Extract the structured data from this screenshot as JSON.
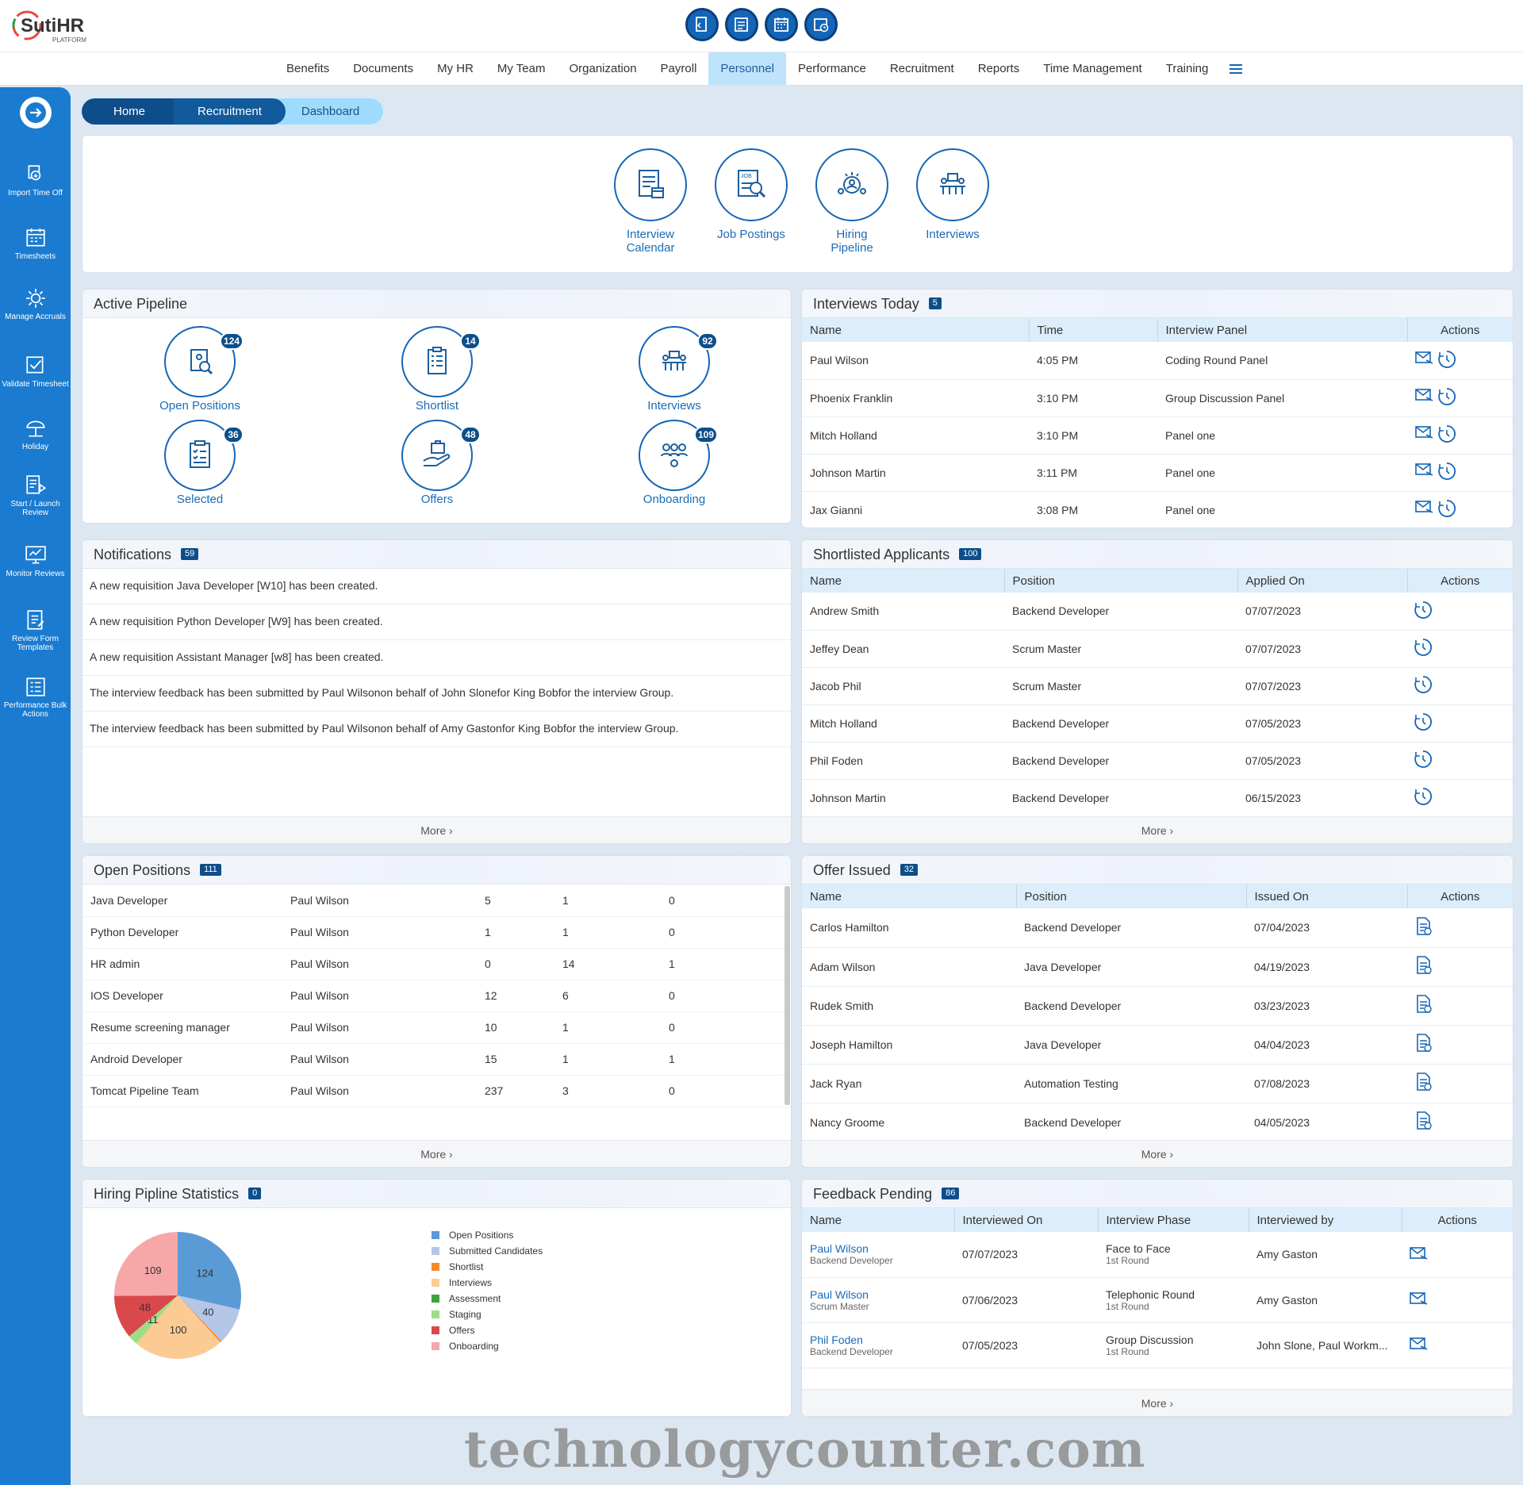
{
  "app": {
    "brand": "SutiHR",
    "brand_sub": "PLATFORM"
  },
  "top_icons": [
    "document-icon",
    "timesheet-icon",
    "calendar-icon",
    "calendar-clock-icon"
  ],
  "nav": {
    "items": [
      "Benefits",
      "Documents",
      "My HR",
      "My Team",
      "Organization",
      "Payroll",
      "Personnel",
      "Performance",
      "Recruitment",
      "Reports",
      "Time Management",
      "Training"
    ],
    "active": "Personnel"
  },
  "sidebar": {
    "menu_label": "Menu",
    "items": [
      {
        "label": "Import Time Off",
        "icon": "import-time-off-icon"
      },
      {
        "label": "Timesheets",
        "icon": "timesheets-icon"
      },
      {
        "label": "Manage Accruals",
        "icon": "gear-icon"
      },
      {
        "label": "Validate Timesheet",
        "icon": "validate-icon"
      },
      {
        "label": "Holiday",
        "icon": "beach-umbrella-icon"
      },
      {
        "label": "Start / Launch Review",
        "icon": "launch-review-icon"
      },
      {
        "label": "Monitor Reviews",
        "icon": "monitor-icon"
      },
      {
        "label": "Review Form Templates",
        "icon": "form-template-icon"
      },
      {
        "label": "Performance Bulk Actions",
        "icon": "bulk-actions-icon"
      }
    ]
  },
  "breadcrumb": [
    "Home",
    "Recruitment",
    "Dashboard"
  ],
  "quick_links": [
    {
      "label": "Interview Calendar",
      "icon": "interview-calendar-icon"
    },
    {
      "label": "Job Postings",
      "icon": "job-postings-icon"
    },
    {
      "label": "Hiring Pipeline",
      "icon": "hiring-pipeline-icon"
    },
    {
      "label": "Interviews",
      "icon": "interviews-icon"
    }
  ],
  "active_pipeline": {
    "title": "Active Pipeline",
    "items": [
      {
        "label": "Open Positions",
        "count": "124"
      },
      {
        "label": "Shortlist",
        "count": "14"
      },
      {
        "label": "Interviews",
        "count": "92"
      },
      {
        "label": "Selected",
        "count": "36"
      },
      {
        "label": "Offers",
        "count": "48"
      },
      {
        "label": "Onboarding",
        "count": "109"
      }
    ]
  },
  "interviews_today": {
    "title": "Interviews Today",
    "count": "5",
    "columns": [
      "Name",
      "Time",
      "Interview Panel",
      "Actions"
    ],
    "rows": [
      [
        "Paul Wilson",
        "4:05 PM",
        "Coding Round Panel"
      ],
      [
        "Phoenix Franklin",
        "3:10 PM",
        "Group Discussion Panel"
      ],
      [
        "Mitch Holland",
        "3:10 PM",
        "Panel one"
      ],
      [
        "Johnson Martin",
        "3:11 PM",
        "Panel one"
      ],
      [
        "Jax Gianni",
        "3:08 PM",
        "Panel one"
      ]
    ]
  },
  "notifications": {
    "title": "Notifications",
    "count": "59",
    "items": [
      "A new requisition Java Developer [W10] has been created.",
      "A new requisition Python Developer [W9] has been created.",
      "A new requisition Assistant Manager [w8] has been created.",
      "The interview feedback has been submitted by Paul Wilsonon behalf of John Slonefor King Bobfor the interview Group.",
      "The interview feedback has been submitted by Paul Wilsonon behalf of Amy Gastonfor King Bobfor the interview Group."
    ],
    "more": "More ›"
  },
  "shortlisted": {
    "title": "Shortlisted Applicants",
    "count": "100",
    "columns": [
      "Name",
      "Position",
      "Applied On",
      "Actions"
    ],
    "rows": [
      [
        "Andrew Smith",
        "Backend Developer",
        "07/07/2023"
      ],
      [
        "Jeffey Dean",
        "Scrum Master",
        "07/07/2023"
      ],
      [
        "Jacob Phil",
        "Scrum Master",
        "07/07/2023"
      ],
      [
        "Mitch Holland",
        "Backend Developer",
        "07/05/2023"
      ],
      [
        "Phil Foden",
        "Backend Developer",
        "07/05/2023"
      ],
      [
        "Johnson Martin",
        "Backend Developer",
        "06/15/2023"
      ]
    ],
    "more": "More ›"
  },
  "open_positions": {
    "title": "Open Positions",
    "count": "111",
    "rows": [
      [
        "Java Developer",
        "Paul Wilson",
        "5",
        "1",
        "0"
      ],
      [
        "Python Developer",
        "Paul Wilson",
        "1",
        "1",
        "0"
      ],
      [
        "HR admin",
        "Paul Wilson",
        "0",
        "14",
        "1"
      ],
      [
        "IOS Developer",
        "Paul Wilson",
        "12",
        "6",
        "0"
      ],
      [
        "Resume screening manager",
        "Paul Wilson",
        "10",
        "1",
        "0"
      ],
      [
        "Android Developer",
        "Paul Wilson",
        "15",
        "1",
        "1"
      ],
      [
        "Tomcat Pipeline Team",
        "Paul Wilson",
        "237",
        "3",
        "0"
      ]
    ],
    "more": "More ›"
  },
  "offer_issued": {
    "title": "Offer Issued",
    "count": "32",
    "columns": [
      "Name",
      "Position",
      "Issued On",
      "Actions"
    ],
    "rows": [
      [
        "Carlos Hamilton",
        "Backend Developer",
        "07/04/2023"
      ],
      [
        "Adam Wilson",
        "Java Developer",
        "04/19/2023"
      ],
      [
        "Rudek Smith",
        "Backend Developer",
        "03/23/2023"
      ],
      [
        "Joseph Hamilton",
        "Java Developer",
        "04/04/2023"
      ],
      [
        "Jack Ryan",
        "Automation Testing",
        "07/08/2023"
      ],
      [
        "Nancy Groome",
        "Backend Developer",
        "04/05/2023"
      ]
    ],
    "more": "More ›"
  },
  "hiring_stats": {
    "title": "Hiring Pipline Statistics",
    "count": "0"
  },
  "chart_data": {
    "type": "pie",
    "categories": [
      "Open Positions",
      "Submitted Candidates",
      "Shortlist",
      "Interviews",
      "Assessment",
      "Staging",
      "Offers",
      "Onboarding"
    ],
    "values": [
      124,
      40,
      2,
      100,
      0,
      11,
      48,
      109
    ],
    "colors": [
      "#5b9bd5",
      "#b4c7e7",
      "#f4892b",
      "#fbcb93",
      "#3ea23e",
      "#9fdc86",
      "#d9484b",
      "#f7a7a7"
    ],
    "legend": "right"
  },
  "feedback_pending": {
    "title": "Feedback Pending",
    "count": "86",
    "columns": [
      "Name",
      "Interviewed On",
      "Interview Phase",
      "Interviewed by",
      "Actions"
    ],
    "rows": [
      {
        "name": "Paul Wilson",
        "position": "Backend Developer",
        "date": "07/07/2023",
        "phase": "Face to Face",
        "round": "1st Round",
        "by": "Amy Gaston"
      },
      {
        "name": "Paul Wilson",
        "position": "Scrum Master",
        "date": "07/06/2023",
        "phase": "Telephonic Round",
        "round": "1st Round",
        "by": "Amy Gaston"
      },
      {
        "name": "Phil Foden",
        "position": "Backend Developer",
        "date": "07/05/2023",
        "phase": "Group Discussion",
        "round": "1st Round",
        "by": "John Slone, Paul Workm..."
      }
    ],
    "more": "More ›"
  },
  "watermark": "technologycounter.com"
}
